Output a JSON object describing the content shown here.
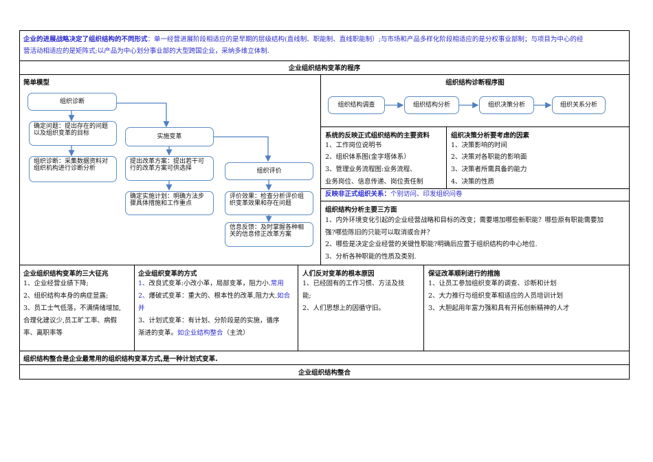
{
  "intro": {
    "heading": "企业的进展战略决定了组织结构的不同形式",
    "line1": "：单一经营进展阶段相适应的是早期的层级结构(直线制、职能制、直线职能制）;与市场和产品多样化阶段相适应的是分权事业部制；与项目为中心的经",
    "line2": "营活动相适应的是矩阵式;以产品为中心划分事业部的大型跨国企业，采纳多维立体制."
  },
  "procedure_title": "企业组织结构变革的程序",
  "simple_model": {
    "label": "简单模型",
    "boxes": {
      "diagnose": "组织诊断",
      "problem": "确定问题：提出存在的问题以及组织变革的目标",
      "collect": "组织诊断：采集数据资料对组织机构进行诊断分析",
      "implement": "实施变革",
      "propose": "提出改革方案：提出若干可行的改革方案可供选择",
      "plan": "确定实施计划：明确方法步骤具体措施和工作重点",
      "evaluate": "组织评价",
      "effect": "评价效果：检查分析评价组织变革效果和存在问题",
      "feedback": "信息反馈：及时掌握各种相关的信息修正改革方案"
    }
  },
  "diagnosis_procedure": {
    "title": "组织结构诊断程序图",
    "steps": [
      "组织结构调查",
      "组织结构分析",
      "组织决策分析",
      "组织关系分析"
    ]
  },
  "formal_materials": {
    "title": "系统的反映正式组织结构的主要资料",
    "items": [
      "1、工作岗位说明书",
      "2、组织体系图(金字塔体系）",
      "3、管理业务流程图:业务流程、",
      "业务岗位、信息传递、岗位责任制"
    ]
  },
  "decision_factors": {
    "title": "组织决策分析要考虑的因素",
    "items": [
      "1、决策影响的时间",
      "2、决策对各职能的影响面",
      "3、决策者所需具备的能力",
      "4、决策的性质"
    ]
  },
  "informal": {
    "label": "反映非正式组织关系：",
    "text": "个别访问、印发组织问卷"
  },
  "three_aspects": {
    "title": "组织结构分析主要三方面",
    "lines": [
      "1、内外环境变化引起的企业经营战略和目标的改变；需要增加哪些新职能？哪些原有职能需要加",
      "强?哪些陈旧的只能可以取消或合并？",
      "2、哪些是决定企业经营的关键性职能?明确后应置于组织结构的中心地位.",
      "3、分析各种职能的性质及类别."
    ]
  },
  "signs": {
    "title": "企业组织结构变革的三大征兆",
    "lines": [
      "1、企业经营业绩下降;",
      "2、组织结构本身的病症显露;",
      "3、员工士气低落，不满情绪增加,",
      "合理化建议少,员工旷工率、病假",
      "率、离职率等"
    ]
  },
  "methods": {
    "title": "企业组织变革的方式",
    "m1_num": "1、",
    "m1": "改良式变革:小改小革，局部变革，阻力小.",
    "m1_blue": "常用",
    "m2_num": "2、",
    "m2": "爆破式变革：重大的、根本性的改革,阻力大.",
    "m2_blue": "如合并",
    "m3a": "3、计划式变革：有计划、分阶段是的实施，循序",
    "m3b": "渐进的变革。",
    "m3_blue": "如企业结构整合",
    "m3c": "（主流）"
  },
  "resistance": {
    "title": "人们反对变革的根本原因",
    "lines": [
      "1、已经固有的工作习惯、方法及技",
      "能;",
      "2、人们思想上的因循守旧。"
    ]
  },
  "measures": {
    "title": "保证改革顺利进行的措施",
    "lines": [
      "1、让员工参加组织变革的调查、诊断和计划",
      "2、大力推行与组织变革相适应的人员培训计划",
      "3、大胆起用年富力强和具有开拓创新精神的人才"
    ]
  },
  "integration_note": "组织结构整合是企业最常用的组织结构变革方式,是一种计划式变革.",
  "integration_title": "企业组织结构整合",
  "colors": {
    "blue_text": "#2a2ad0",
    "box_border": "#5b8bc4",
    "arrow": "#4f7fbf"
  }
}
